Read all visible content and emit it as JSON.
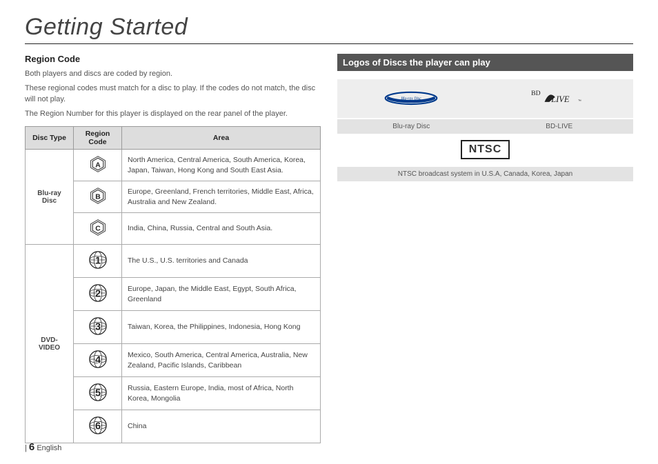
{
  "page_title": "Getting Started",
  "left": {
    "heading": "Region Code",
    "para1": "Both players and discs are coded by region.",
    "para2": "These regional codes must match for a disc to play. If the codes do not match, the disc will not play.",
    "para3": "The Region Number for this player is displayed on the rear panel of the player.",
    "table": {
      "headers": [
        "Disc Type",
        "Region Code",
        "Area"
      ],
      "groups": [
        {
          "type": "Blu-ray Disc",
          "rows": [
            {
              "icon": "A",
              "area": "North America, Central America, South America, Korea, Japan, Taiwan, Hong Kong and South East Asia."
            },
            {
              "icon": "B",
              "area": "Europe, Greenland, French territories, Middle East, Africa, Australia and New Zealand."
            },
            {
              "icon": "C",
              "area": "India, China, Russia, Central and South Asia."
            }
          ]
        },
        {
          "type": "DVD-VIDEO",
          "rows": [
            {
              "icon": "1",
              "area": "The U.S., U.S. territories and Canada"
            },
            {
              "icon": "2",
              "area": "Europe, Japan, the Middle East, Egypt, South Africa, Greenland"
            },
            {
              "icon": "3",
              "area": "Taiwan, Korea, the Philippines, Indonesia, Hong Kong"
            },
            {
              "icon": "4",
              "area": "Mexico, South America, Central America, Australia, New Zealand, Pacific Islands, Caribbean"
            },
            {
              "icon": "5",
              "area": "Russia, Eastern Europe, India, most of Africa, North Korea, Mongolia"
            },
            {
              "icon": "6",
              "area": "China"
            }
          ]
        }
      ]
    }
  },
  "right": {
    "heading": "Logos of Discs the player can play",
    "logos": {
      "row1": [
        {
          "name": "bluray-disc-logo",
          "label": "Blu-ray Disc"
        },
        {
          "name": "bd-live-logo",
          "label": "BD-LIVE"
        }
      ],
      "row2": {
        "name": "ntsc-logo",
        "box_text": "NTSC",
        "label": "NTSC broadcast system in U.S.A, Canada, Korea, Japan"
      }
    }
  },
  "footer": {
    "page_number": "6",
    "lang": "English"
  }
}
